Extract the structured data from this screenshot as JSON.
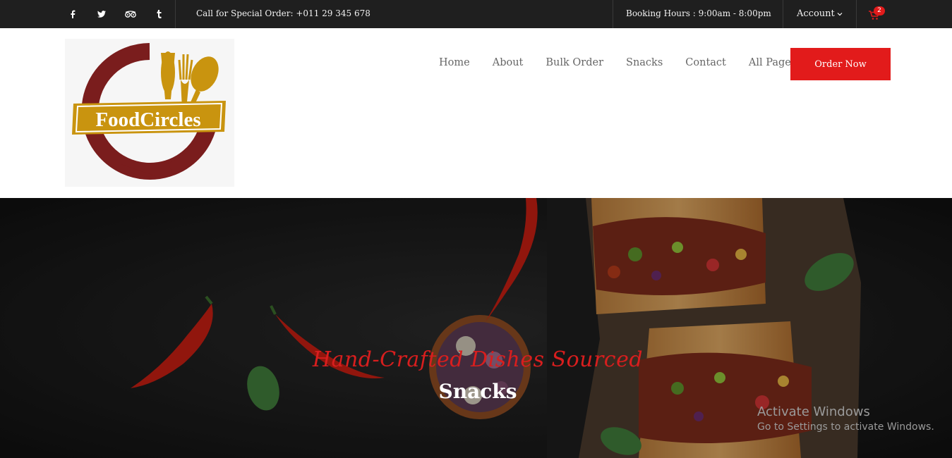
{
  "topbar": {
    "social": [
      {
        "name": "facebook-icon",
        "glyph": "f"
      },
      {
        "name": "twitter-icon",
        "glyph": "t"
      },
      {
        "name": "tripadvisor-icon",
        "glyph": "o"
      },
      {
        "name": "tumblr-icon",
        "glyph": "t"
      }
    ],
    "call_text": "Call for Special Order: +011 29 345 678",
    "booking_text": "Booking Hours : 9:00am - 8:00pm",
    "account_label": "Account",
    "cart_count": "2"
  },
  "header": {
    "logo_text": "FoodCircles",
    "nav": [
      "Home",
      "About",
      "Bulk Order",
      "Snacks",
      "Contact",
      "All Pages"
    ],
    "order_button": "Order Now"
  },
  "hero": {
    "tagline": "Hand-Crafted Dishes Sourced",
    "title": "Snacks"
  },
  "os_overlay": {
    "line1": "Activate Windows",
    "line2": "Go to Settings to activate Windows."
  },
  "colors": {
    "accent": "#e21b1b",
    "topbar": "#1f1f1f",
    "logo_maroon": "#7a1d1d",
    "logo_gold": "#c9940f"
  }
}
